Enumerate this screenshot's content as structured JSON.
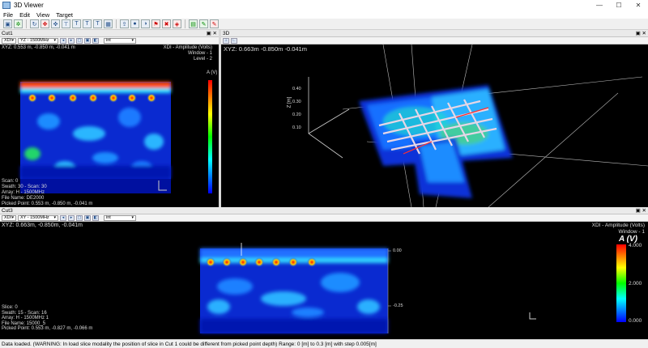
{
  "window": {
    "title": "3D Viewer",
    "controls": [
      "—",
      "☐",
      "✕"
    ]
  },
  "menu": [
    "File",
    "Edit",
    "View",
    "Target"
  ],
  "cut1": {
    "header": "Cut1",
    "combo1": "XDI",
    "combo2": "YZ - 1500MHz",
    "combo3": "int",
    "xyz": "XYZ: 0.553 m, -0.850 m, -0.041 m",
    "right_label": "XDI - Amplitude (Volts)\nWindow - 1\nLevel - 2",
    "unit": "A (V)",
    "info": "Scan: 0\nSwath: 30 - Scan: 30\nArray: H - 1500MHz\nFile Name: DE2000\nPicked Point: 0.553 m, -0.850 m, -0.041 m"
  },
  "view3d": {
    "header": "3D",
    "xyz": "XYZ: 0.663m -0.850m -0.041m",
    "axis_z": "Z [m]",
    "ticks": [
      "0.10",
      "0.20",
      "0.30",
      "0.40"
    ]
  },
  "cut3": {
    "header": "Cut3",
    "combo1": "XDI",
    "combo2": "XY - 1500MHz",
    "combo3": "int",
    "xyz": "XYZ: 0.663m, -0.850m, -0.041m",
    "right_label": "XDI - Amplitude (Volts)\nWindow - 1",
    "unit": "A (V)",
    "scale_max": "4.000",
    "scale_mid": "2.000",
    "scale_min": "0.000",
    "depth_top": "0.00",
    "depth_mid": "-0.25",
    "info": "Slice: 0\nSwath: 15 - Scan: 16\nArray: H - 1500MHz 1\nFile Name: 15000_5\nPicked Point: 0.553 m, -0.827 m, -0.066 m"
  },
  "status": "Data loaded. (WARNING: In load slice modality the position of slice in Cut 1 could be different from picked point depth)   Range: 0 [m] to 0.3 [m] with step 0.005[m]",
  "colors": {
    "scale_top": "#ff0000",
    "scale_mid": "#00ff00",
    "scale_bottom": "#0000ff"
  }
}
